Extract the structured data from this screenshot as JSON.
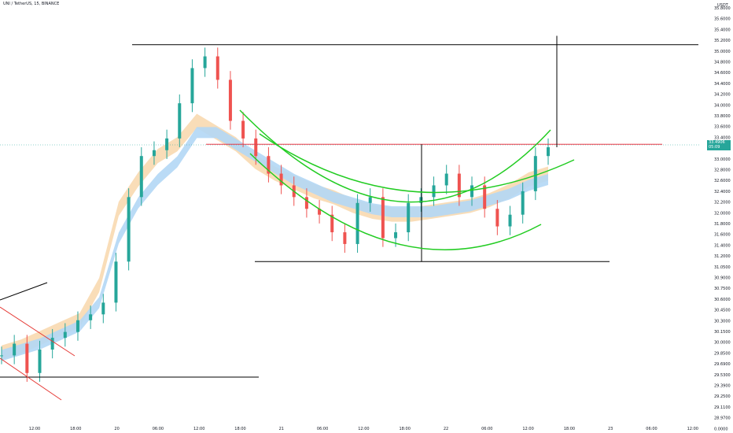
{
  "header": {
    "title": "UNI / TetherUS, 15, BINANCE"
  },
  "price_axis": {
    "currency": "USDT",
    "current_price": "33.4906",
    "countdown": "05:09",
    "badge_color": "#26a69a"
  },
  "chart_data": {
    "type": "candlestick",
    "title": "UNI / TetherUS, 15, BINANCE",
    "ylabel": "USDT",
    "ylim": [
      28.9,
      35.9
    ],
    "y_ticks": [
      "35.8000",
      "35.6000",
      "35.4000",
      "35.2000",
      "35.0000",
      "34.8000",
      "34.6000",
      "34.4000",
      "34.2000",
      "34.0000",
      "33.8000",
      "33.6000",
      "33.4000",
      "33.2000",
      "33.0000",
      "32.8000",
      "32.6000",
      "32.4000",
      "32.2000",
      "32.0000",
      "31.8000",
      "31.6000",
      "31.4000",
      "31.2000",
      "31.0500",
      "30.9000",
      "30.7500",
      "30.6000",
      "30.4500",
      "30.3000",
      "30.1500",
      "30.0000",
      "29.8500",
      "29.6900",
      "29.5300",
      "29.3900",
      "29.2500",
      "29.1100",
      "28.9700",
      "0.0000"
    ],
    "x_ticks": [
      "12:00",
      "18:00",
      "20",
      "06:00",
      "12:00",
      "18:00",
      "21",
      "06:00",
      "12:00",
      "18:00",
      "22",
      "06:00",
      "12:00",
      "18:00",
      "23",
      "06:00",
      "12:00"
    ],
    "series": [
      {
        "kind": "EMA ribbon",
        "color": "#f8d9b0",
        "values": [
          29.95,
          30.05,
          30.2,
          30.35,
          30.5,
          31.1,
          32.4,
          32.9,
          33.3,
          33.5,
          33.9,
          33.7,
          33.5,
          33.2,
          33.0,
          32.85,
          32.7,
          32.6,
          32.45,
          32.35,
          32.3,
          32.3,
          32.35,
          32.4,
          32.45,
          32.55,
          32.7,
          32.9,
          33.0
        ]
      },
      {
        "kind": "EMA ribbon",
        "color": "#b3d7f5",
        "values": [
          29.9,
          30.0,
          30.1,
          30.25,
          30.4,
          30.8,
          31.9,
          32.5,
          32.9,
          33.2,
          33.7,
          33.7,
          33.5,
          33.3,
          33.1,
          32.9,
          32.75,
          32.6,
          32.5,
          32.4,
          32.35,
          32.35,
          32.35,
          32.4,
          32.45,
          32.55,
          32.65,
          32.8,
          32.9
        ]
      }
    ],
    "candles_close": [
      29.9,
      30.1,
      29.6,
      30.0,
      30.2,
      30.3,
      30.5,
      30.6,
      30.8,
      31.5,
      32.6,
      33.3,
      33.4,
      33.6,
      34.2,
      34.8,
      35.0,
      34.6,
      33.9,
      33.6,
      33.3,
      33.0,
      32.8,
      32.6,
      32.4,
      32.3,
      32.0,
      31.8,
      32.5,
      32.6,
      31.9,
      32.0,
      32.5,
      32.6,
      32.8,
      33.0,
      32.6,
      32.8,
      32.4,
      32.1,
      32.3,
      32.7,
      33.3,
      33.45
    ],
    "annotations": {
      "horizontal_lines": [
        {
          "price": 35.2,
          "color": "#000000"
        },
        {
          "price": 33.5,
          "color": "#f23645"
        },
        {
          "price": 31.5,
          "color": "#000000"
        },
        {
          "price": 29.53,
          "color": "#000000"
        }
      ],
      "vertical_lines": [
        {
          "from": 31.5,
          "to": 33.5,
          "color": "#000000"
        },
        {
          "from": 33.45,
          "to": 35.35,
          "color": "#000000"
        }
      ],
      "arcs": "three green cup curves",
      "channel": "red descending channel lines"
    },
    "grid": false,
    "legend": "none"
  }
}
